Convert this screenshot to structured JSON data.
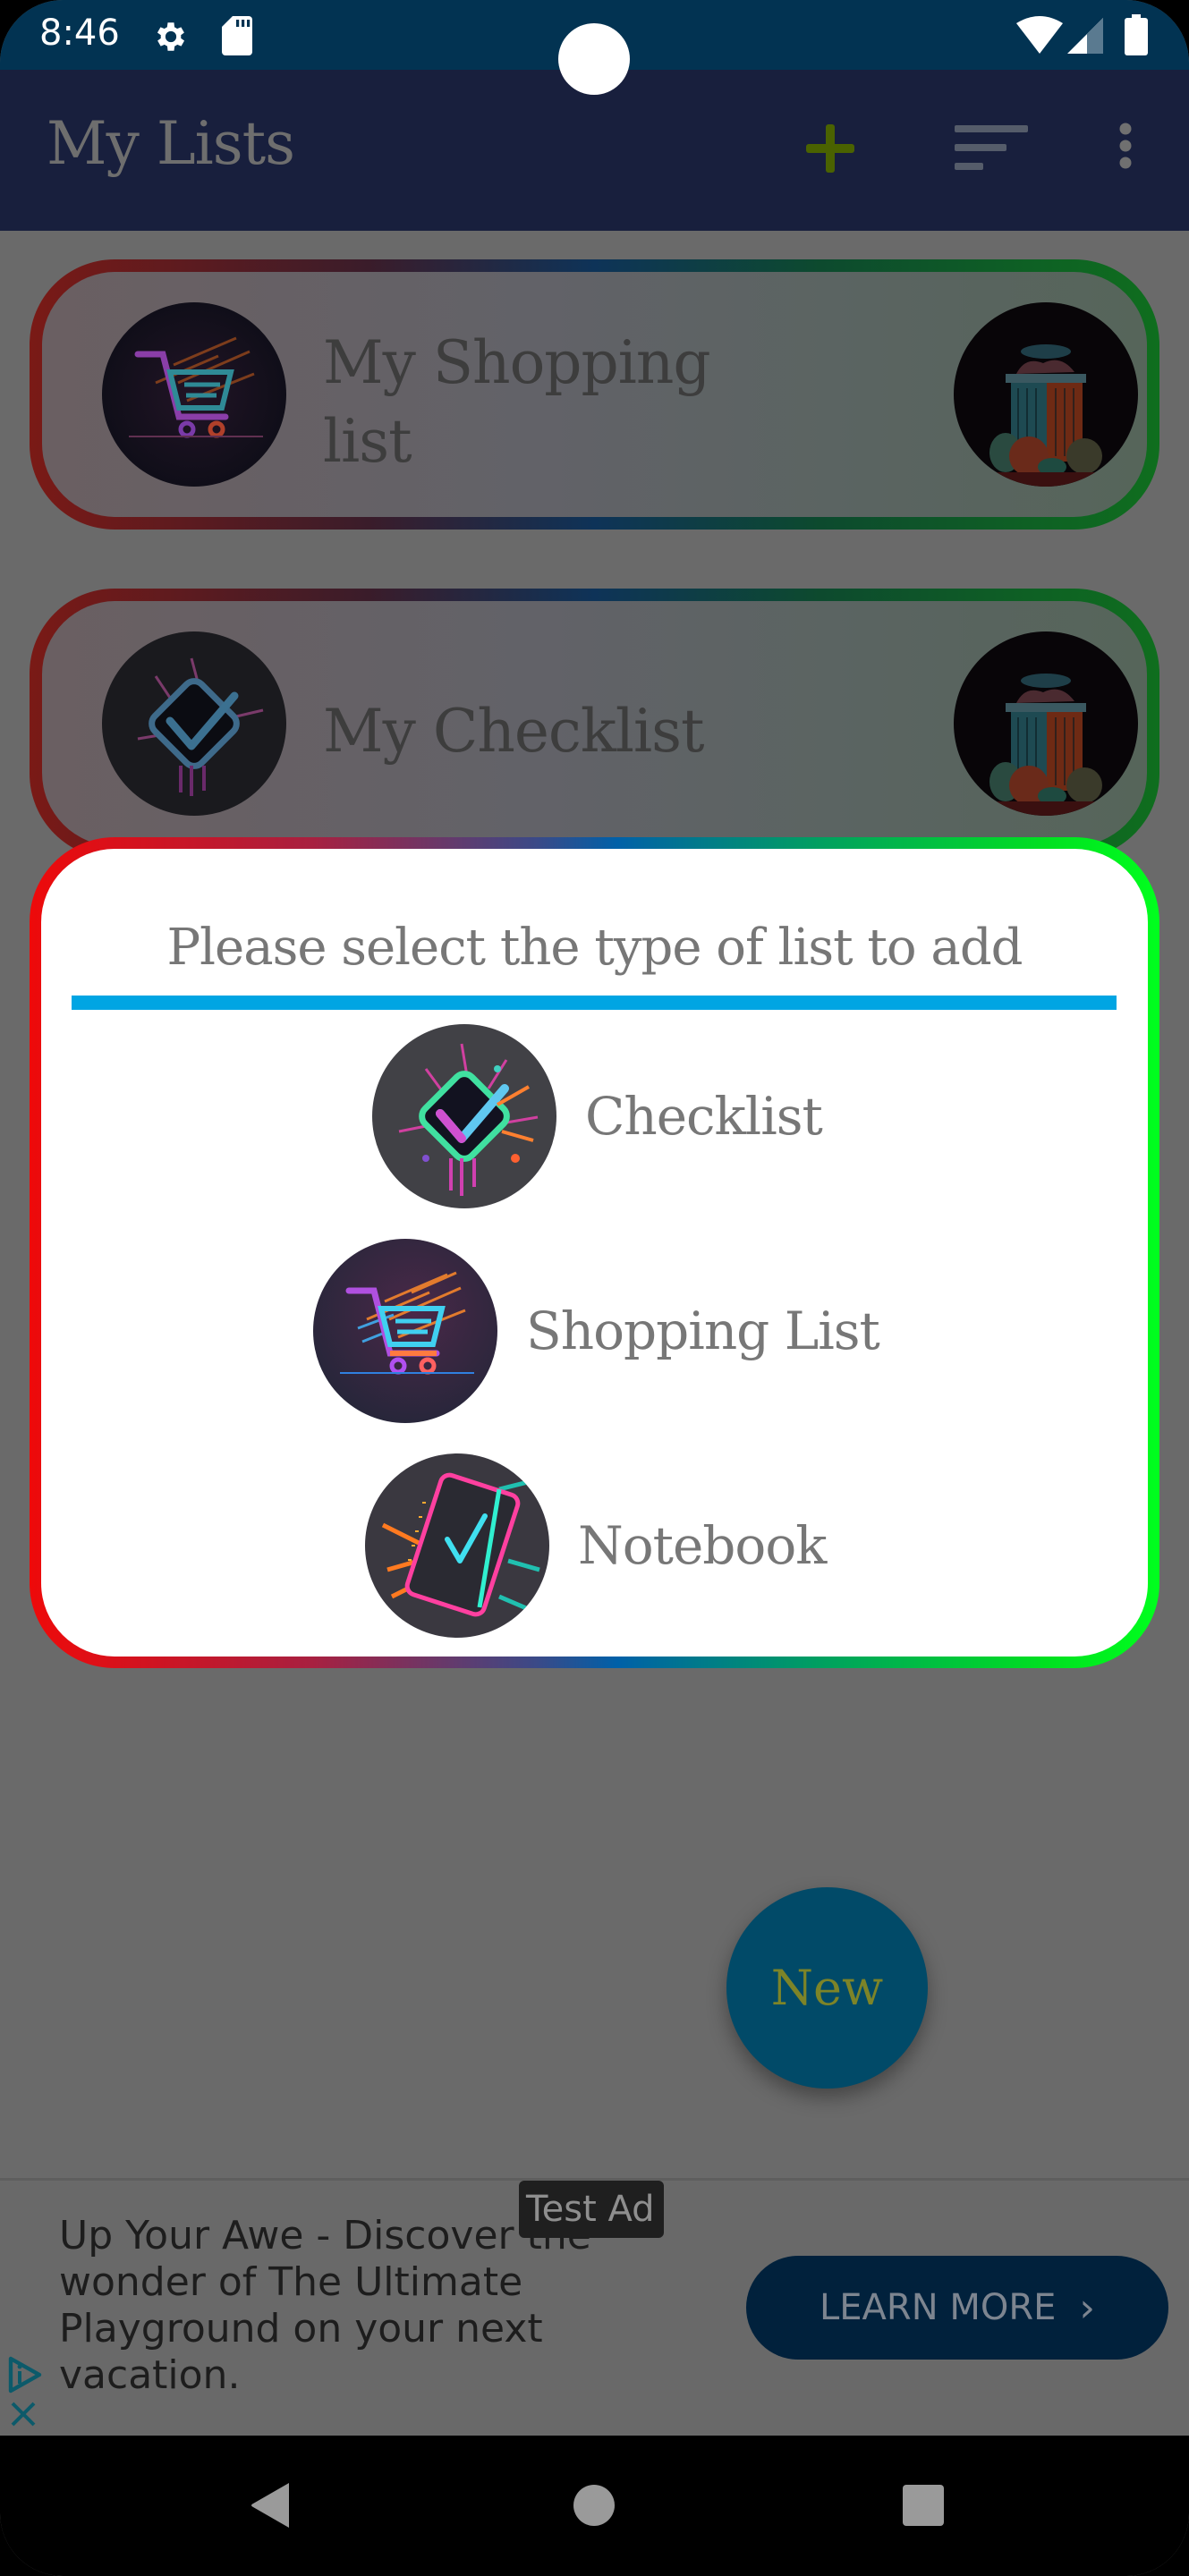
{
  "status_bar": {
    "time": "8:46",
    "icons": [
      "settings-gear-icon",
      "sd-card-icon",
      "wifi-icon",
      "cell-signal-icon",
      "battery-icon"
    ]
  },
  "app_bar": {
    "title": "My Lists",
    "actions": [
      {
        "name": "add",
        "icon": "plus-icon",
        "color": "#4a6200"
      },
      {
        "name": "sort",
        "icon": "sort-icon"
      },
      {
        "name": "more",
        "icon": "more-vertical-icon"
      }
    ]
  },
  "lists": [
    {
      "title": "My Shopping list",
      "type_icon": "shopping-cart-icon",
      "action_icon": "trash-bin-icon"
    },
    {
      "title": "My Checklist",
      "type_icon": "checklist-icon",
      "action_icon": "trash-bin-icon"
    }
  ],
  "dialog": {
    "title": "Please select the type of list to add",
    "options": [
      {
        "label": "Checklist",
        "icon": "checklist-icon"
      },
      {
        "label": "Shopping List",
        "icon": "shopping-cart-icon"
      },
      {
        "label": "Notebook",
        "icon": "notebook-icon"
      }
    ],
    "divider_color": "#00a5e3"
  },
  "fab": {
    "label": "New"
  },
  "ad": {
    "badge": "Test Ad",
    "text": "Up Your Awe - Discover the wonder of The Ultimate Playground on your next vacation.",
    "cta": "LEARN MORE",
    "cta_chevron": "›"
  },
  "nav_bar": {
    "buttons": [
      "back",
      "home",
      "recents"
    ]
  },
  "colors": {
    "status_bar": "#023352",
    "app_bar": "#181f3d",
    "scrim_background": "#6a6a6a",
    "dialog_border_start": "#ee0a0a",
    "dialog_border_end": "#00ff1e",
    "fab": "#014a68",
    "cta": "#01213c"
  }
}
